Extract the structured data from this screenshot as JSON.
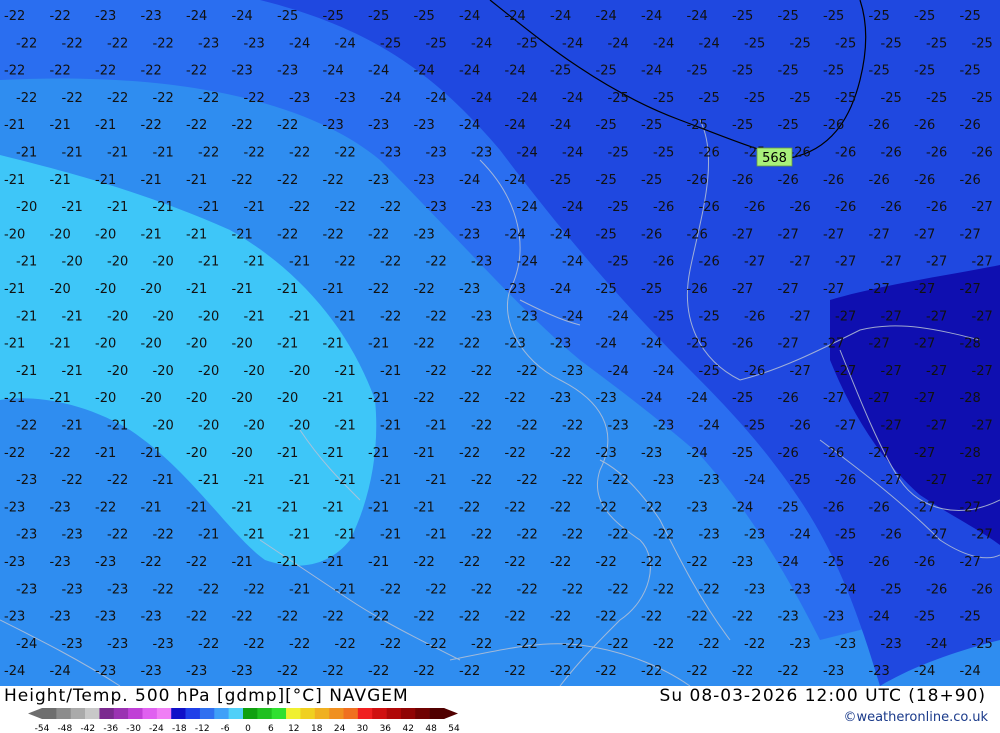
{
  "map": {
    "height_label": "568",
    "isotherm_labels": [
      {
        "row": 0,
        "values": [
          "-22",
          "-22",
          "-23",
          "-23",
          "-24",
          "-24",
          "-25",
          "-25",
          "-25",
          "-25",
          "-24",
          "-24",
          "-24",
          "-24",
          "-24",
          "-24",
          "-25",
          "-25",
          "-25",
          "-25",
          "-25",
          "-25"
        ]
      },
      {
        "row": 1,
        "values": [
          "-22",
          "-22",
          "-22",
          "-22",
          "-23",
          "-23",
          "-24",
          "-24",
          "-25",
          "-25",
          "-24",
          "-25",
          "-24",
          "-24",
          "-24",
          "-24",
          "-25",
          "-25",
          "-25",
          "-25",
          "-25",
          "-25"
        ]
      },
      {
        "row": 2,
        "values": [
          "-22",
          "-22",
          "-22",
          "-22",
          "-22",
          "-23",
          "-23",
          "-24",
          "-24",
          "-24",
          "-24",
          "-24",
          "-25",
          "-25",
          "-24",
          "-25",
          "-25",
          "-25",
          "-25",
          "-25",
          "-25",
          "-25"
        ]
      },
      {
        "row": 3,
        "values": [
          "-22",
          "-22",
          "-22",
          "-22",
          "-22",
          "-22",
          "-23",
          "-23",
          "-24",
          "-24",
          "-24",
          "-24",
          "-24",
          "-25",
          "-25",
          "-25",
          "-25",
          "-25",
          "-25",
          "-25",
          "-25",
          "-25"
        ]
      },
      {
        "row": 4,
        "values": [
          "-21",
          "-21",
          "-21",
          "-22",
          "-22",
          "-22",
          "-22",
          "-23",
          "-23",
          "-23",
          "-24",
          "-24",
          "-24",
          "-25",
          "-25",
          "-25",
          "-25",
          "-25",
          "-26",
          "-26",
          "-26",
          "-26"
        ]
      },
      {
        "row": 5,
        "values": [
          "-21",
          "-21",
          "-21",
          "-21",
          "-22",
          "-22",
          "-22",
          "-22",
          "-23",
          "-23",
          "-23",
          "-24",
          "-24",
          "-25",
          "-25",
          "-26",
          "-25",
          "-26",
          "-26",
          "-26",
          "-26",
          "-26"
        ]
      },
      {
        "row": 6,
        "values": [
          "-21",
          "-21",
          "-21",
          "-21",
          "-21",
          "-22",
          "-22",
          "-22",
          "-23",
          "-23",
          "-24",
          "-24",
          "-25",
          "-25",
          "-25",
          "-26",
          "-26",
          "-26",
          "-26",
          "-26",
          "-26",
          "-26"
        ]
      },
      {
        "row": 7,
        "values": [
          "-20",
          "-21",
          "-21",
          "-21",
          "-21",
          "-21",
          "-22",
          "-22",
          "-22",
          "-23",
          "-23",
          "-24",
          "-24",
          "-25",
          "-26",
          "-26",
          "-26",
          "-26",
          "-26",
          "-26",
          "-26",
          "-27"
        ]
      },
      {
        "row": 8,
        "values": [
          "-20",
          "-20",
          "-20",
          "-21",
          "-21",
          "-21",
          "-22",
          "-22",
          "-22",
          "-23",
          "-23",
          "-24",
          "-24",
          "-25",
          "-26",
          "-26",
          "-27",
          "-27",
          "-27",
          "-27",
          "-27",
          "-27"
        ]
      },
      {
        "row": 9,
        "values": [
          "-21",
          "-20",
          "-20",
          "-20",
          "-21",
          "-21",
          "-21",
          "-22",
          "-22",
          "-22",
          "-23",
          "-24",
          "-24",
          "-25",
          "-26",
          "-26",
          "-27",
          "-27",
          "-27",
          "-27",
          "-27",
          "-27"
        ]
      },
      {
        "row": 10,
        "values": [
          "-21",
          "-20",
          "-20",
          "-20",
          "-21",
          "-21",
          "-21",
          "-21",
          "-22",
          "-22",
          "-23",
          "-23",
          "-24",
          "-25",
          "-25",
          "-26",
          "-27",
          "-27",
          "-27",
          "-27",
          "-27",
          "-27"
        ]
      },
      {
        "row": 11,
        "values": [
          "-21",
          "-21",
          "-20",
          "-20",
          "-20",
          "-21",
          "-21",
          "-21",
          "-22",
          "-22",
          "-23",
          "-23",
          "-24",
          "-24",
          "-25",
          "-25",
          "-26",
          "-27",
          "-27",
          "-27",
          "-27",
          "-27"
        ]
      },
      {
        "row": 12,
        "values": [
          "-21",
          "-21",
          "-20",
          "-20",
          "-20",
          "-20",
          "-21",
          "-21",
          "-21",
          "-22",
          "-22",
          "-23",
          "-23",
          "-24",
          "-24",
          "-25",
          "-26",
          "-27",
          "-27",
          "-27",
          "-27",
          "-28"
        ]
      },
      {
        "row": 13,
        "values": [
          "-21",
          "-21",
          "-20",
          "-20",
          "-20",
          "-20",
          "-20",
          "-21",
          "-21",
          "-22",
          "-22",
          "-22",
          "-23",
          "-24",
          "-24",
          "-25",
          "-26",
          "-27",
          "-27",
          "-27",
          "-27",
          "-27"
        ]
      },
      {
        "row": 14,
        "values": [
          "-21",
          "-21",
          "-20",
          "-20",
          "-20",
          "-20",
          "-20",
          "-21",
          "-21",
          "-22",
          "-22",
          "-22",
          "-23",
          "-23",
          "-24",
          "-24",
          "-25",
          "-26",
          "-27",
          "-27",
          "-27",
          "-28"
        ]
      },
      {
        "row": 15,
        "values": [
          "-22",
          "-21",
          "-21",
          "-20",
          "-20",
          "-20",
          "-20",
          "-21",
          "-21",
          "-21",
          "-22",
          "-22",
          "-22",
          "-23",
          "-23",
          "-24",
          "-25",
          "-26",
          "-27",
          "-27",
          "-27",
          "-27"
        ]
      },
      {
        "row": 16,
        "values": [
          "-22",
          "-22",
          "-21",
          "-21",
          "-20",
          "-20",
          "-21",
          "-21",
          "-21",
          "-21",
          "-22",
          "-22",
          "-22",
          "-23",
          "-23",
          "-24",
          "-25",
          "-26",
          "-26",
          "-27",
          "-27",
          "-28"
        ]
      },
      {
        "row": 17,
        "values": [
          "-23",
          "-22",
          "-22",
          "-21",
          "-21",
          "-21",
          "-21",
          "-21",
          "-21",
          "-21",
          "-22",
          "-22",
          "-22",
          "-22",
          "-23",
          "-23",
          "-24",
          "-25",
          "-26",
          "-27",
          "-27",
          "-27"
        ]
      },
      {
        "row": 18,
        "values": [
          "-23",
          "-23",
          "-22",
          "-21",
          "-21",
          "-21",
          "-21",
          "-21",
          "-21",
          "-21",
          "-22",
          "-22",
          "-22",
          "-22",
          "-22",
          "-23",
          "-24",
          "-25",
          "-26",
          "-26",
          "-27",
          "-27"
        ]
      },
      {
        "row": 19,
        "values": [
          "-23",
          "-23",
          "-22",
          "-22",
          "-21",
          "-21",
          "-21",
          "-21",
          "-21",
          "-21",
          "-22",
          "-22",
          "-22",
          "-22",
          "-22",
          "-23",
          "-23",
          "-24",
          "-25",
          "-26",
          "-27",
          "-27"
        ]
      },
      {
        "row": 20,
        "values": [
          "-23",
          "-23",
          "-23",
          "-22",
          "-22",
          "-21",
          "-21",
          "-21",
          "-21",
          "-22",
          "-22",
          "-22",
          "-22",
          "-22",
          "-22",
          "-22",
          "-23",
          "-24",
          "-25",
          "-26",
          "-26",
          "-27"
        ]
      },
      {
        "row": 21,
        "values": [
          "-23",
          "-23",
          "-23",
          "-22",
          "-22",
          "-22",
          "-21",
          "-21",
          "-22",
          "-22",
          "-22",
          "-22",
          "-22",
          "-22",
          "-22",
          "-22",
          "-23",
          "-23",
          "-24",
          "-25",
          "-26",
          "-26"
        ]
      },
      {
        "row": 22,
        "values": [
          "-23",
          "-23",
          "-23",
          "-23",
          "-22",
          "-22",
          "-22",
          "-22",
          "-22",
          "-22",
          "-22",
          "-22",
          "-22",
          "-22",
          "-22",
          "-22",
          "-22",
          "-23",
          "-23",
          "-24",
          "-25",
          "-25"
        ]
      },
      {
        "row": 23,
        "values": [
          "-24",
          "-23",
          "-23",
          "-23",
          "-22",
          "-22",
          "-22",
          "-22",
          "-22",
          "-22",
          "-22",
          "-22",
          "-22",
          "-22",
          "-22",
          "-22",
          "-22",
          "-23",
          "-23",
          "-23",
          "-24",
          "-25"
        ]
      },
      {
        "row": 24,
        "values": [
          "-24",
          "-24",
          "-23",
          "-23",
          "-23",
          "-23",
          "-22",
          "-22",
          "-22",
          "-22",
          "-22",
          "-22",
          "-22",
          "-22",
          "-22",
          "-22",
          "-22",
          "-22",
          "-23",
          "-23",
          "-24",
          "-24"
        ]
      }
    ]
  },
  "footer": {
    "title": "Height/Temp. 500 hPa [gdmp][°C] NAVGEM",
    "datetime": "Su 08-03-2026 12:00 UTC (18+90)",
    "credit": "©weatheronline.co.uk",
    "colorbar": {
      "ticks": [
        "-54",
        "-48",
        "-42",
        "-36",
        "-30",
        "-24",
        "-18",
        "-12",
        "-6",
        "0",
        "6",
        "12",
        "18",
        "24",
        "30",
        "36",
        "42",
        "48",
        "54"
      ],
      "colors": [
        "#6e6e6e",
        "#8c8c8c",
        "#aaaaaa",
        "#c8c8c8",
        "#7b2a8f",
        "#9b32b2",
        "#c040d6",
        "#e060f0",
        "#f07ef5",
        "#1010c8",
        "#2040e8",
        "#3070f0",
        "#40a0f8",
        "#50d0f8",
        "#10a010",
        "#20c020",
        "#30e030",
        "#f0f030",
        "#f0d020",
        "#f0b020",
        "#f09020",
        "#f07020",
        "#f02020",
        "#d01010",
        "#b00808",
        "#900404",
        "#700202",
        "#500000"
      ]
    }
  }
}
